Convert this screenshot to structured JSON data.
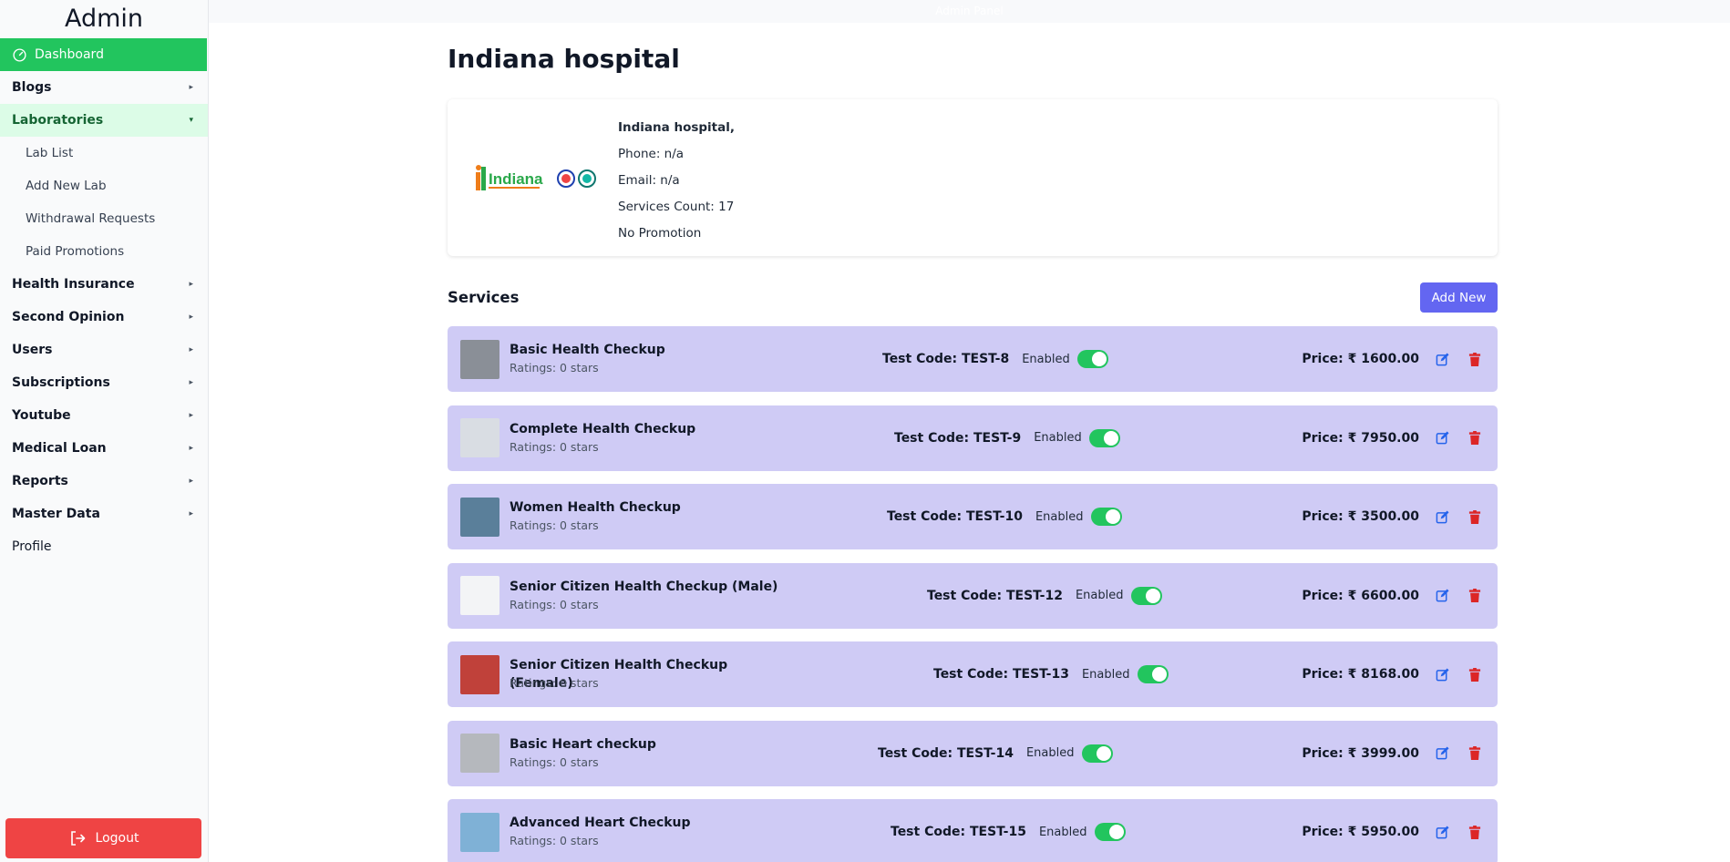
{
  "app": {
    "brand": "Admin",
    "topbar_text": "Admin Panel"
  },
  "sidebar": {
    "dashboard": "Dashboard",
    "items": [
      {
        "label": "Blogs",
        "caret": "▸",
        "type": "section"
      },
      {
        "label": "Laboratories",
        "caret": "▾",
        "type": "open"
      },
      {
        "label": "Lab List",
        "type": "sub"
      },
      {
        "label": "Add New Lab",
        "type": "sub"
      },
      {
        "label": "Withdrawal Requests",
        "type": "sub"
      },
      {
        "label": "Paid Promotions",
        "type": "sub"
      },
      {
        "label": "Health Insurance",
        "caret": "▸",
        "type": "section"
      },
      {
        "label": "Second Opinion",
        "caret": "▸",
        "type": "section"
      },
      {
        "label": "Users",
        "caret": "▸",
        "type": "section"
      },
      {
        "label": "Subscriptions",
        "caret": "▸",
        "type": "section"
      },
      {
        "label": "Youtube",
        "caret": "▸",
        "type": "section"
      },
      {
        "label": "Medical Loan",
        "caret": "▸",
        "type": "section"
      },
      {
        "label": "Reports",
        "caret": "▸",
        "type": "section"
      },
      {
        "label": "Master Data",
        "caret": "▸",
        "type": "section"
      },
      {
        "label": "Profile",
        "type": "plain"
      }
    ],
    "logout": "Logout"
  },
  "lab": {
    "title": "Indiana hospital",
    "logo_text": "Indiana",
    "name": "Indiana hospital,",
    "phone": "Phone: n/a",
    "email": "Email: n/a",
    "services_count": "Services Count: 17",
    "promotion": "No Promotion"
  },
  "services": {
    "heading": "Services",
    "add_label": "Add New",
    "enabled_label": "Enabled",
    "items": [
      {
        "name": "Basic Health Checkup",
        "rating": "Ratings: 0 stars",
        "code": "Test Code: TEST-8",
        "price": "Price: ₹ 1600.00",
        "thumb": "#8a8f97"
      },
      {
        "name": "Complete Health Checkup",
        "rating": "Ratings: 0 stars",
        "code": "Test Code: TEST-9",
        "price": "Price: ₹ 7950.00",
        "thumb": "#d9dde3"
      },
      {
        "name": "Women Health Checkup",
        "rating": "Ratings: 0 stars",
        "code": "Test Code: TEST-10",
        "price": "Price: ₹ 3500.00",
        "thumb": "#5a7f9a"
      },
      {
        "name": "Senior Citizen Health Checkup (Male)",
        "rating": "Ratings: 0 stars",
        "code": "Test Code: TEST-12",
        "price": "Price: ₹ 6600.00",
        "thumb": "#f3f4f6"
      },
      {
        "name": "Senior Citizen Health Checkup (Female)",
        "rating": "Ratings: 0 stars",
        "code": "Test Code: TEST-13",
        "price": "Price: ₹ 8168.00",
        "thumb": "#c0413a"
      },
      {
        "name": "Basic Heart checkup",
        "rating": "Ratings: 0 stars",
        "code": "Test Code: TEST-14",
        "price": "Price: ₹ 3999.00",
        "thumb": "#b5b8bd"
      },
      {
        "name": "Advanced Heart Checkup",
        "rating": "Ratings: 0 stars",
        "code": "Test Code: TEST-15",
        "price": "Price: ₹ 5950.00",
        "thumb": "#7fb1d6"
      }
    ]
  },
  "colors": {
    "accent": "#22c55e",
    "primary": "#6366f1",
    "danger": "#ef4444",
    "row": "#cfcbf5",
    "edit": "#2563eb",
    "delete": "#dc2626"
  }
}
